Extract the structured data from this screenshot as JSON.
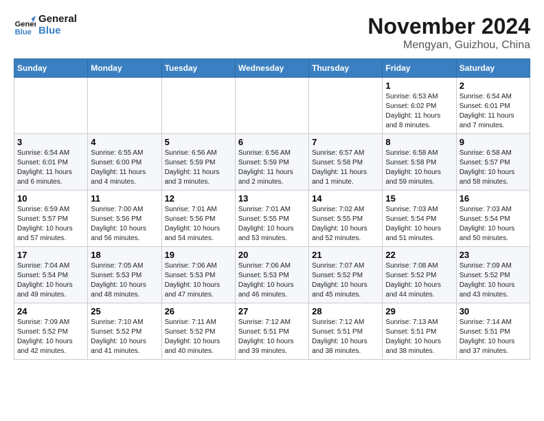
{
  "header": {
    "logo_line1": "General",
    "logo_line2": "Blue",
    "month": "November 2024",
    "location": "Mengyan, Guizhou, China"
  },
  "weekdays": [
    "Sunday",
    "Monday",
    "Tuesday",
    "Wednesday",
    "Thursday",
    "Friday",
    "Saturday"
  ],
  "weeks": [
    [
      {
        "day": "",
        "info": ""
      },
      {
        "day": "",
        "info": ""
      },
      {
        "day": "",
        "info": ""
      },
      {
        "day": "",
        "info": ""
      },
      {
        "day": "",
        "info": ""
      },
      {
        "day": "1",
        "info": "Sunrise: 6:53 AM\nSunset: 6:02 PM\nDaylight: 11 hours\nand 8 minutes."
      },
      {
        "day": "2",
        "info": "Sunrise: 6:54 AM\nSunset: 6:01 PM\nDaylight: 11 hours\nand 7 minutes."
      }
    ],
    [
      {
        "day": "3",
        "info": "Sunrise: 6:54 AM\nSunset: 6:01 PM\nDaylight: 11 hours\nand 6 minutes."
      },
      {
        "day": "4",
        "info": "Sunrise: 6:55 AM\nSunset: 6:00 PM\nDaylight: 11 hours\nand 4 minutes."
      },
      {
        "day": "5",
        "info": "Sunrise: 6:56 AM\nSunset: 5:59 PM\nDaylight: 11 hours\nand 3 minutes."
      },
      {
        "day": "6",
        "info": "Sunrise: 6:56 AM\nSunset: 5:59 PM\nDaylight: 11 hours\nand 2 minutes."
      },
      {
        "day": "7",
        "info": "Sunrise: 6:57 AM\nSunset: 5:58 PM\nDaylight: 11 hours\nand 1 minute."
      },
      {
        "day": "8",
        "info": "Sunrise: 6:58 AM\nSunset: 5:58 PM\nDaylight: 10 hours\nand 59 minutes."
      },
      {
        "day": "9",
        "info": "Sunrise: 6:58 AM\nSunset: 5:57 PM\nDaylight: 10 hours\nand 58 minutes."
      }
    ],
    [
      {
        "day": "10",
        "info": "Sunrise: 6:59 AM\nSunset: 5:57 PM\nDaylight: 10 hours\nand 57 minutes."
      },
      {
        "day": "11",
        "info": "Sunrise: 7:00 AM\nSunset: 5:56 PM\nDaylight: 10 hours\nand 56 minutes."
      },
      {
        "day": "12",
        "info": "Sunrise: 7:01 AM\nSunset: 5:56 PM\nDaylight: 10 hours\nand 54 minutes."
      },
      {
        "day": "13",
        "info": "Sunrise: 7:01 AM\nSunset: 5:55 PM\nDaylight: 10 hours\nand 53 minutes."
      },
      {
        "day": "14",
        "info": "Sunrise: 7:02 AM\nSunset: 5:55 PM\nDaylight: 10 hours\nand 52 minutes."
      },
      {
        "day": "15",
        "info": "Sunrise: 7:03 AM\nSunset: 5:54 PM\nDaylight: 10 hours\nand 51 minutes."
      },
      {
        "day": "16",
        "info": "Sunrise: 7:03 AM\nSunset: 5:54 PM\nDaylight: 10 hours\nand 50 minutes."
      }
    ],
    [
      {
        "day": "17",
        "info": "Sunrise: 7:04 AM\nSunset: 5:54 PM\nDaylight: 10 hours\nand 49 minutes."
      },
      {
        "day": "18",
        "info": "Sunrise: 7:05 AM\nSunset: 5:53 PM\nDaylight: 10 hours\nand 48 minutes."
      },
      {
        "day": "19",
        "info": "Sunrise: 7:06 AM\nSunset: 5:53 PM\nDaylight: 10 hours\nand 47 minutes."
      },
      {
        "day": "20",
        "info": "Sunrise: 7:06 AM\nSunset: 5:53 PM\nDaylight: 10 hours\nand 46 minutes."
      },
      {
        "day": "21",
        "info": "Sunrise: 7:07 AM\nSunset: 5:52 PM\nDaylight: 10 hours\nand 45 minutes."
      },
      {
        "day": "22",
        "info": "Sunrise: 7:08 AM\nSunset: 5:52 PM\nDaylight: 10 hours\nand 44 minutes."
      },
      {
        "day": "23",
        "info": "Sunrise: 7:09 AM\nSunset: 5:52 PM\nDaylight: 10 hours\nand 43 minutes."
      }
    ],
    [
      {
        "day": "24",
        "info": "Sunrise: 7:09 AM\nSunset: 5:52 PM\nDaylight: 10 hours\nand 42 minutes."
      },
      {
        "day": "25",
        "info": "Sunrise: 7:10 AM\nSunset: 5:52 PM\nDaylight: 10 hours\nand 41 minutes."
      },
      {
        "day": "26",
        "info": "Sunrise: 7:11 AM\nSunset: 5:52 PM\nDaylight: 10 hours\nand 40 minutes."
      },
      {
        "day": "27",
        "info": "Sunrise: 7:12 AM\nSunset: 5:51 PM\nDaylight: 10 hours\nand 39 minutes."
      },
      {
        "day": "28",
        "info": "Sunrise: 7:12 AM\nSunset: 5:51 PM\nDaylight: 10 hours\nand 38 minutes."
      },
      {
        "day": "29",
        "info": "Sunrise: 7:13 AM\nSunset: 5:51 PM\nDaylight: 10 hours\nand 38 minutes."
      },
      {
        "day": "30",
        "info": "Sunrise: 7:14 AM\nSunset: 5:51 PM\nDaylight: 10 hours\nand 37 minutes."
      }
    ]
  ]
}
